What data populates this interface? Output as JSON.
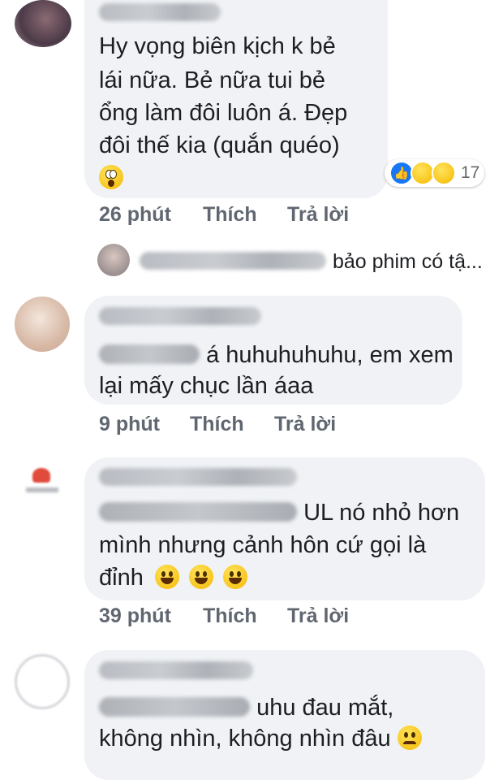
{
  "comments": [
    {
      "lines": [
        "Hy vọng biên kịch k bẻ",
        "lái nữa. Bẻ nữa tui bẻ",
        "ổng làm đôi luôn á. Đẹp",
        "đôi thế kia (quắn quéo)"
      ],
      "emoji": "astonished-face",
      "reactions": {
        "icons": [
          "like-icon",
          "haha-icon",
          "sad-icon"
        ],
        "count": "17"
      },
      "time": "26 phút",
      "like_label": "Thích",
      "reply_label": "Trả lời"
    },
    {
      "reply_preview": "bảo phim có tậ..."
    },
    {
      "line1_suffix": "á huhuhuhuhu, em xem",
      "line2": "lại mấy chục lần áaa",
      "time": "9 phút",
      "like_label": "Thích",
      "reply_label": "Trả lời"
    },
    {
      "line1_suffix": "UL nó nhỏ hơn",
      "line2": "mình nhưng cảnh hôn cứ gọi là",
      "line3": "đỉnh",
      "emoji": "grinning-face",
      "time": "39 phút",
      "like_label": "Thích",
      "reply_label": "Trả lời"
    },
    {
      "line1_suffix": "uhu đau mắt,",
      "line2": "không nhìn, không nhìn đâu",
      "emoji": "sad-face"
    }
  ]
}
